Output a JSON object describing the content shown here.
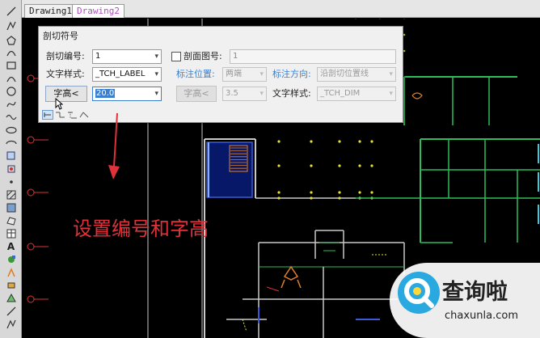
{
  "tabs": [
    {
      "label": "Drawing1",
      "active": false
    },
    {
      "label": "Drawing2",
      "active": true
    }
  ],
  "toolbar": {
    "icons": [
      "line-icon",
      "polyline-icon",
      "polygon-icon",
      "arc-icon",
      "rectangle-icon",
      "arc-icon",
      "circle-icon",
      "curve-icon",
      "wave-icon",
      "ellipse-icon",
      "ellipse-arc-icon",
      "insert-block-icon",
      "make-block-icon",
      "point-icon",
      "hatch-icon",
      "gradient-icon",
      "region-icon",
      "table-icon",
      "text-icon",
      "add-selected-icon",
      "paint-icon",
      "layer-icon",
      "match-icon"
    ],
    "text_tool": "A"
  },
  "dialog": {
    "title": "剖切符号",
    "section_number_label": "剖切编号:",
    "section_number_value": "1",
    "section_view_label": "剖面图号:",
    "section_view_checked": false,
    "section_view_value": "1",
    "text_style_label": "文字样式:",
    "text_style_value": "_TCH_LABEL",
    "label_position_label": "标注位置:",
    "label_position_value": "两端",
    "label_direction_label": "标注方向:",
    "label_direction_value": "沿剖切位置线",
    "text_height_button": "字高<",
    "text_height_value": "20.0",
    "text_height2_button": "字高<",
    "text_height2_value": "3.5",
    "text_style2_label": "文字样式:",
    "text_style2_value": "_TCH_DIM"
  },
  "annotation": {
    "text": "设置编号和字高",
    "color": "#e0323a"
  },
  "watermark": {
    "brand": "查询啦",
    "url": "chaxunla.com",
    "accent": "#2aa8e0"
  },
  "colors": {
    "canvas": "#000000",
    "wall": "#c9c9c9",
    "green": "#2dbd5a",
    "yellow": "#e8e13a",
    "cyan": "#3ac9e0",
    "red": "#d83535",
    "orange": "#e0802a",
    "blue": "#3a5ad8"
  }
}
